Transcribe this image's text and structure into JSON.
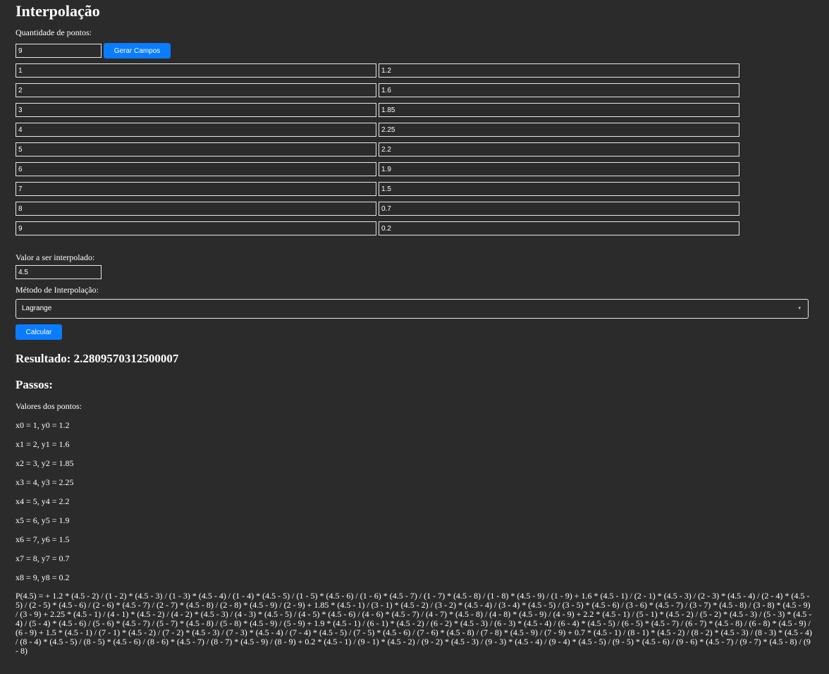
{
  "title": "Interpolação",
  "count": {
    "label": "Quantidade de pontos:",
    "value": "9",
    "button_label": "Gerar Campos"
  },
  "points": [
    {
      "x": "1",
      "y": "1.2"
    },
    {
      "x": "2",
      "y": "1.6"
    },
    {
      "x": "3",
      "y": "1.85"
    },
    {
      "x": "4",
      "y": "2.25"
    },
    {
      "x": "5",
      "y": "2.2"
    },
    {
      "x": "6",
      "y": "1.9"
    },
    {
      "x": "7",
      "y": "1.5"
    },
    {
      "x": "8",
      "y": "0.7"
    },
    {
      "x": "9",
      "y": "0.2"
    }
  ],
  "interp": {
    "label": "Valor a ser interpolado:",
    "value": "4.5"
  },
  "method": {
    "label": "Método de Interpolação:",
    "selected": "Lagrange"
  },
  "calc_button": "Calcular",
  "result": "Resultado: 2.2809570312500007",
  "steps": {
    "heading": "Passos:",
    "intro": "Valores dos pontos:",
    "lines": [
      "x0 = 1, y0 = 1.2",
      "x1 = 2, y1 = 1.6",
      "x2 = 3, y2 = 1.85",
      "x3 = 4, y3 = 2.25",
      "x4 = 5, y4 = 2.2",
      "x5 = 6, y5 = 1.9",
      "x6 = 7, y6 = 1.5",
      "x7 = 8, y7 = 0.7",
      "x8 = 9, y8 = 0.2"
    ],
    "formula": "P(4.5) = + 1.2 * (4.5 - 2) / (1 - 2) * (4.5 - 3) / (1 - 3) * (4.5 - 4) / (1 - 4) * (4.5 - 5) / (1 - 5) * (4.5 - 6) / (1 - 6) * (4.5 - 7) / (1 - 7) * (4.5 - 8) / (1 - 8) * (4.5 - 9) / (1 - 9) + 1.6 * (4.5 - 1) / (2 - 1) * (4.5 - 3) / (2 - 3) * (4.5 - 4) / (2 - 4) * (4.5 - 5) / (2 - 5) * (4.5 - 6) / (2 - 6) * (4.5 - 7) / (2 - 7) * (4.5 - 8) / (2 - 8) * (4.5 - 9) / (2 - 9) + 1.85 * (4.5 - 1) / (3 - 1) * (4.5 - 2) / (3 - 2) * (4.5 - 4) / (3 - 4) * (4.5 - 5) / (3 - 5) * (4.5 - 6) / (3 - 6) * (4.5 - 7) / (3 - 7) * (4.5 - 8) / (3 - 8) * (4.5 - 9) / (3 - 9) + 2.25 * (4.5 - 1) / (4 - 1) * (4.5 - 2) / (4 - 2) * (4.5 - 3) / (4 - 3) * (4.5 - 5) / (4 - 5) * (4.5 - 6) / (4 - 6) * (4.5 - 7) / (4 - 7) * (4.5 - 8) / (4 - 8) * (4.5 - 9) / (4 - 9) + 2.2 * (4.5 - 1) / (5 - 1) * (4.5 - 2) / (5 - 2) * (4.5 - 3) / (5 - 3) * (4.5 - 4) / (5 - 4) * (4.5 - 6) / (5 - 6) * (4.5 - 7) / (5 - 7) * (4.5 - 8) / (5 - 8) * (4.5 - 9) / (5 - 9) + 1.9 * (4.5 - 1) / (6 - 1) * (4.5 - 2) / (6 - 2) * (4.5 - 3) / (6 - 3) * (4.5 - 4) / (6 - 4) * (4.5 - 5) / (6 - 5) * (4.5 - 7) / (6 - 7) * (4.5 - 8) / (6 - 8) * (4.5 - 9) / (6 - 9) + 1.5 * (4.5 - 1) / (7 - 1) * (4.5 - 2) / (7 - 2) * (4.5 - 3) / (7 - 3) * (4.5 - 4) / (7 - 4) * (4.5 - 5) / (7 - 5) * (4.5 - 6) / (7 - 6) * (4.5 - 8) / (7 - 8) * (4.5 - 9) / (7 - 9) + 0.7 * (4.5 - 1) / (8 - 1) * (4.5 - 2) / (8 - 2) * (4.5 - 3) / (8 - 3) * (4.5 - 4) / (8 - 4) * (4.5 - 5) / (8 - 5) * (4.5 - 6) / (8 - 6) * (4.5 - 7) / (8 - 7) * (4.5 - 9) / (8 - 9) + 0.2 * (4.5 - 1) / (9 - 1) * (4.5 - 2) / (9 - 2) * (4.5 - 3) / (9 - 3) * (4.5 - 4) / (9 - 4) * (4.5 - 5) / (9 - 5) * (4.5 - 6) / (9 - 6) * (4.5 - 7) / (9 - 7) * (4.5 - 8) / (9 - 8)"
  },
  "colors": {
    "background": "#2b2b2b",
    "accent": "#0a7cff",
    "text": "#ffffff"
  }
}
